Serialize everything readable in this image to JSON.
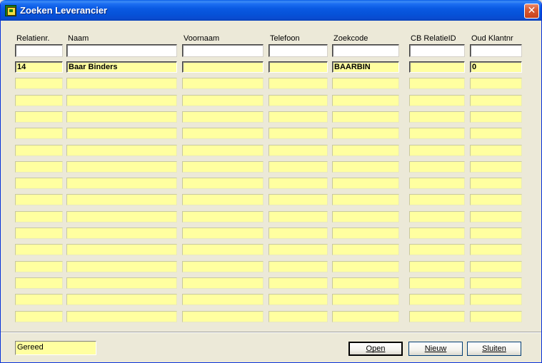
{
  "window": {
    "title": "Zoeken Leverancier",
    "close_glyph": "✕"
  },
  "columns": [
    {
      "label": "Relatienr."
    },
    {
      "label": "Naam"
    },
    {
      "label": "Voornaam"
    },
    {
      "label": "Telefoon"
    },
    {
      "label": "Zoekcode"
    },
    {
      "label": "CB RelatieID"
    },
    {
      "label": "Oud Klantnr"
    }
  ],
  "filters": [
    "",
    "",
    "",
    "",
    "",
    "",
    ""
  ],
  "rows": [
    [
      "14",
      "Baar Binders",
      "",
      "",
      "BAARBIN",
      "",
      "0"
    ],
    [
      "",
      "",
      "",
      "",
      "",
      "",
      ""
    ],
    [
      "",
      "",
      "",
      "",
      "",
      "",
      ""
    ],
    [
      "",
      "",
      "",
      "",
      "",
      "",
      ""
    ],
    [
      "",
      "",
      "",
      "",
      "",
      "",
      ""
    ],
    [
      "",
      "",
      "",
      "",
      "",
      "",
      ""
    ],
    [
      "",
      "",
      "",
      "",
      "",
      "",
      ""
    ],
    [
      "",
      "",
      "",
      "",
      "",
      "",
      ""
    ],
    [
      "",
      "",
      "",
      "",
      "",
      "",
      ""
    ],
    [
      "",
      "",
      "",
      "",
      "",
      "",
      ""
    ],
    [
      "",
      "",
      "",
      "",
      "",
      "",
      ""
    ],
    [
      "",
      "",
      "",
      "",
      "",
      "",
      ""
    ],
    [
      "",
      "",
      "",
      "",
      "",
      "",
      ""
    ],
    [
      "",
      "",
      "",
      "",
      "",
      "",
      ""
    ],
    [
      "",
      "",
      "",
      "",
      "",
      "",
      ""
    ],
    [
      "",
      "",
      "",
      "",
      "",
      "",
      ""
    ]
  ],
  "status": {
    "text": "Gereed"
  },
  "buttons": {
    "open": "Open",
    "new": "Nieuw",
    "close": "Sluiten"
  },
  "colors": {
    "row_bg": "#ffffa0",
    "title_bar": "#0a5ae3",
    "window_bg": "#ece9d8"
  },
  "icons": {
    "app": "app-icon",
    "close": "close-icon"
  }
}
